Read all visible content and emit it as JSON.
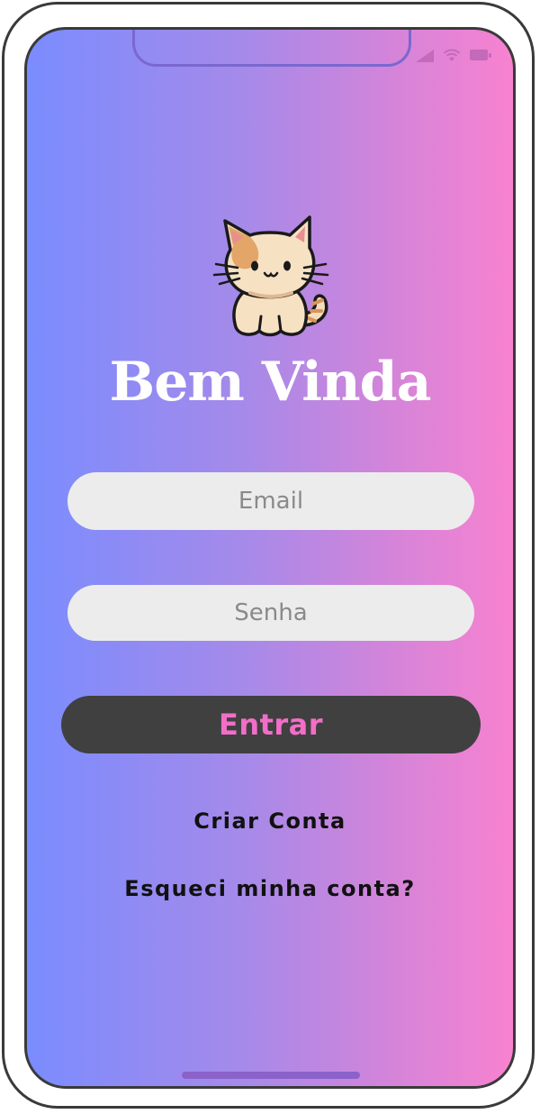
{
  "login": {
    "title": "Bem Vinda",
    "email_placeholder": "Email",
    "password_placeholder": "Senha",
    "submit_label": "Entrar",
    "create_account_label": "Criar Conta",
    "forgot_label": "Esqueci minha conta?"
  },
  "icons": {
    "mascot": "cat-icon",
    "signal": "signal-icon",
    "wifi": "wifi-icon",
    "battery": "battery-icon"
  },
  "colors": {
    "gradient_start": "#7a8cfe",
    "gradient_end": "#f882d0",
    "button_bg": "#404040",
    "button_text": "#f26ec8",
    "field_bg": "#ececec"
  }
}
